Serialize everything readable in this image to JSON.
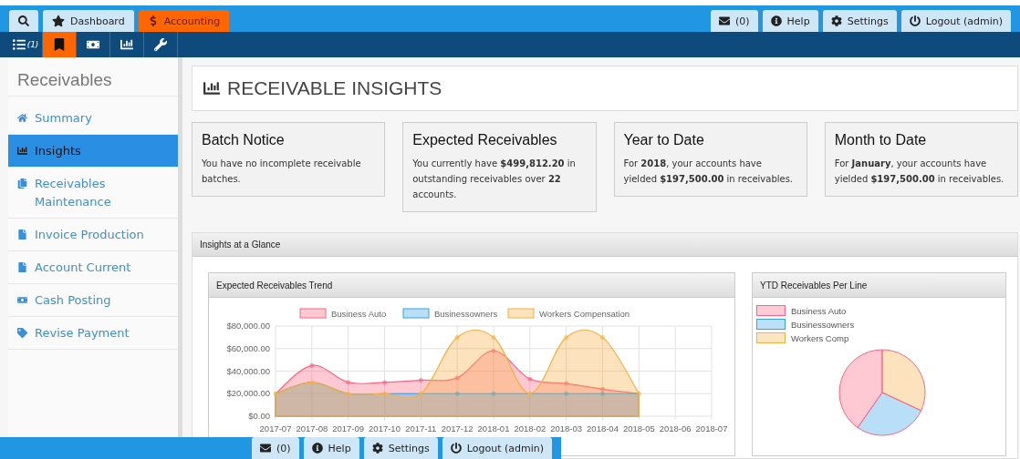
{
  "top_nav": {
    "tabs": [
      {
        "kind": "search",
        "selected": false
      },
      {
        "kind": "star",
        "label": "Dashboard",
        "selected": false
      },
      {
        "kind": "dollar",
        "label": "Accounting",
        "selected": true
      }
    ],
    "buttons": [
      {
        "kind": "mail",
        "label": "(0)"
      },
      {
        "kind": "info",
        "label": "Help"
      },
      {
        "kind": "gear",
        "label": "Settings"
      },
      {
        "kind": "power",
        "label": "Logout (admin)"
      }
    ]
  },
  "sub_nav": [
    {
      "kind": "list",
      "label": "(1)",
      "selected": false
    },
    {
      "kind": "book",
      "selected": true
    },
    {
      "kind": "money",
      "selected": false
    },
    {
      "kind": "chart",
      "selected": false
    },
    {
      "kind": "wrench",
      "selected": false
    }
  ],
  "sidebar": {
    "title": "Receivables",
    "items": [
      {
        "kind": "home",
        "label": "Summary",
        "selected": false
      },
      {
        "kind": "chart",
        "label": "Insights",
        "selected": true
      },
      {
        "kind": "copy",
        "label": "Receivables Maintenance",
        "selected": false
      },
      {
        "kind": "file",
        "label": "Invoice Production",
        "selected": false
      },
      {
        "kind": "file",
        "label": "Account Current",
        "selected": false
      },
      {
        "kind": "money",
        "label": "Cash Posting",
        "selected": false
      },
      {
        "kind": "tag",
        "label": "Revise Payment",
        "selected": false
      }
    ]
  },
  "page_title": "RECEIVABLE INSIGHTS",
  "cards": [
    {
      "title": "Batch Notice",
      "text": "You have no incomplete receivable batches."
    },
    {
      "title": "Expected Receivables",
      "text": "You currently have **$499,812.20** in outstanding receivables over **22** accounts."
    },
    {
      "title": "Year to Date",
      "text": "For **2018**, your accounts have yielded **$197,500.00**  in receivables."
    },
    {
      "title": "Month to Date",
      "text": "For **January**, your accounts have yielded **$197,500.00**  in receivables."
    }
  ],
  "insights_panel": {
    "title": "Insights at a Glance",
    "trend": {
      "title": "Expected Receivables Trend",
      "chart_data": {
        "type": "area",
        "grid": true,
        "legend": true,
        "x": [
          "2017-07",
          "2017-08",
          "2017-09",
          "2017-10",
          "2017-11",
          "2017-12",
          "2018-01",
          "2018-02",
          "2018-03",
          "2018-04",
          "2018-05",
          "2018-06",
          "2018-07"
        ],
        "ylim": [
          0,
          80000
        ],
        "yticks": [
          {
            "value": 0,
            "label": "$0.00"
          },
          {
            "value": 20000,
            "label": "$20,000.00"
          },
          {
            "value": 40000,
            "label": "$40,000.00"
          },
          {
            "value": 60000,
            "label": "$60,000.00"
          },
          {
            "value": 80000,
            "label": "$80,000.00"
          }
        ],
        "series": [
          {
            "name": "Business Auto",
            "color": "#ff6384",
            "values": [
              20000,
              45000,
              30000,
              30000,
              32000,
              34000,
              58000,
              33000,
              29000,
              24000,
              20000,
              null,
              null
            ]
          },
          {
            "name": "Businessowners",
            "color": "#36a2eb",
            "values": [
              20000,
              30000,
              20000,
              20000,
              20000,
              20000,
              20000,
              20000,
              20000,
              20000,
              20000,
              null,
              null
            ]
          },
          {
            "name": "Workers Compensation",
            "color": "#f5b041",
            "values": [
              20000,
              30000,
              20000,
              20000,
              20000,
              70000,
              70000,
              20000,
              70000,
              70000,
              20000,
              null,
              null
            ]
          }
        ]
      }
    },
    "per_line": {
      "title": "YTD Receivables Per Line",
      "legend": [
        {
          "label": "Business Auto",
          "color": "#ff6384"
        },
        {
          "label": "Businessowners",
          "color": "#36a2eb"
        },
        {
          "label": "Workers Comp",
          "color": "#f5b041"
        }
      ]
    }
  },
  "bottom_bar": {
    "buttons": [
      {
        "kind": "mail",
        "label": "(0)"
      },
      {
        "kind": "info",
        "label": "Help"
      },
      {
        "kind": "gear",
        "label": "Settings"
      },
      {
        "kind": "power",
        "label": "Logout (admin)"
      }
    ]
  }
}
